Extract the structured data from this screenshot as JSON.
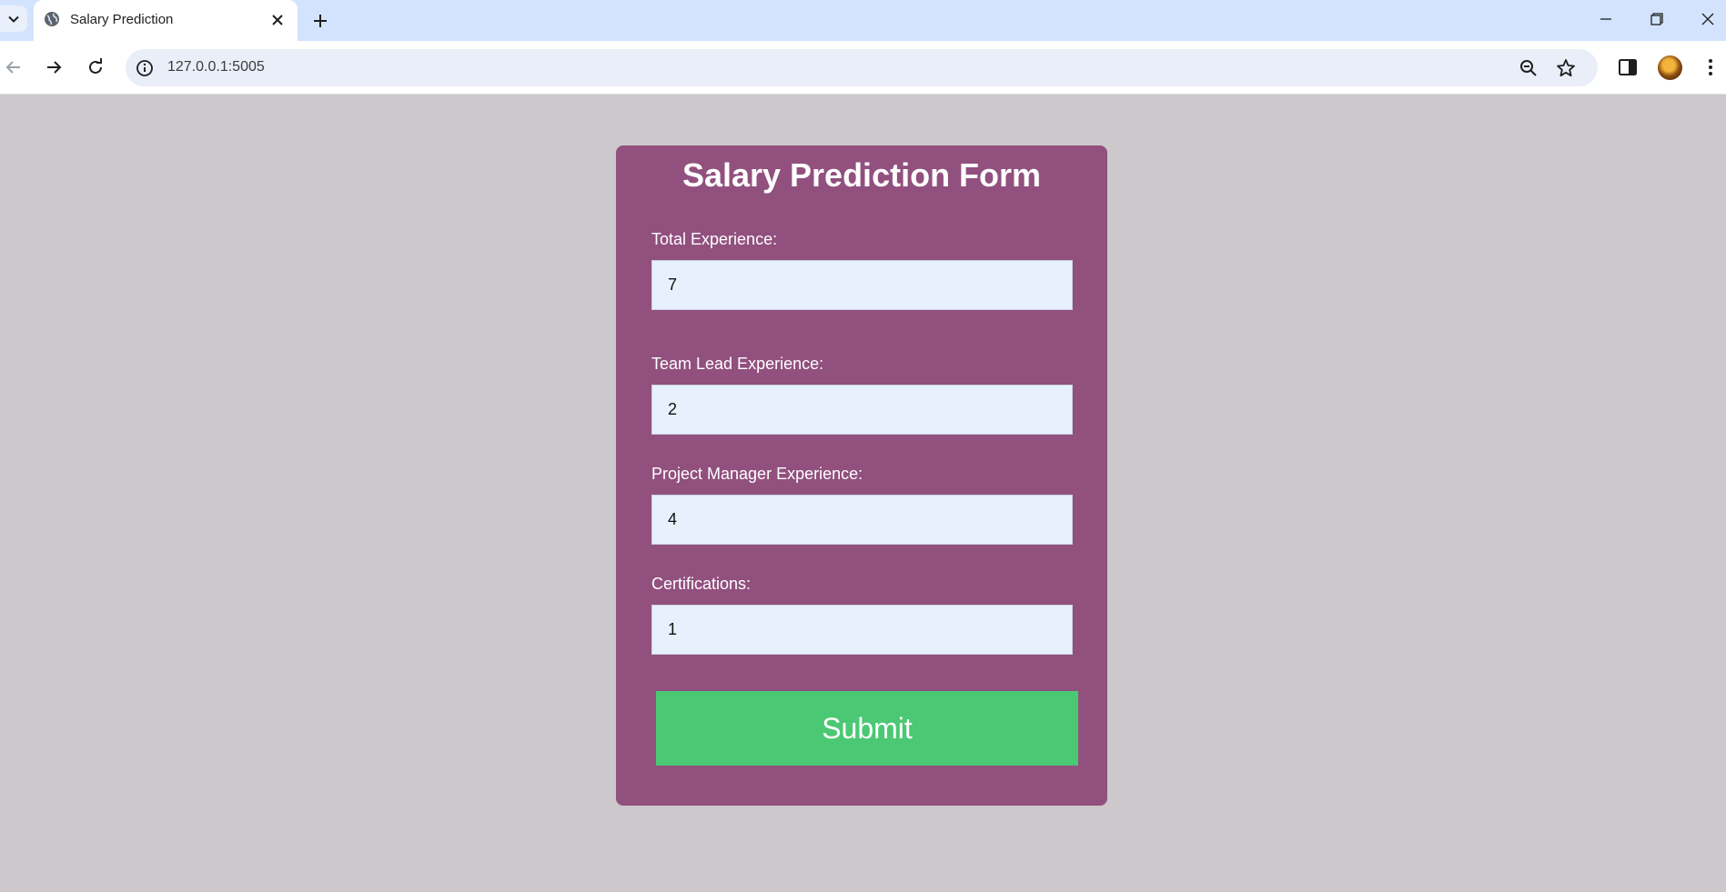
{
  "browser": {
    "tab_title": "Salary Prediction",
    "url": "127.0.0.1:5005"
  },
  "icons": {
    "tab_list": "chevron-down-icon",
    "favicon": "globe-icon",
    "close_tab": "close-icon",
    "new_tab": "plus-icon",
    "minimize": "minimize-icon",
    "restore": "restore-icon",
    "close_window": "close-icon",
    "back": "back-arrow-icon",
    "forward": "forward-arrow-icon",
    "reload": "reload-icon",
    "site_info": "info-icon",
    "zoom": "zoom-icon",
    "bookmark": "star-icon",
    "side_panel": "side-panel-icon",
    "menu": "kebab-menu-icon"
  },
  "colors": {
    "page_background": "#cdc8cc",
    "card_background": "#91507e",
    "input_background": "#e8f0fe",
    "submit_background": "#4bc873"
  },
  "form": {
    "title": "Salary Prediction Form",
    "fields": [
      {
        "label": "Total Experience:",
        "value": "7"
      },
      {
        "label": "Team Lead Experience:",
        "value": "2"
      },
      {
        "label": "Project Manager Experience:",
        "value": "4"
      },
      {
        "label": "Certifications:",
        "value": "1"
      }
    ],
    "submit_label": "Submit"
  }
}
